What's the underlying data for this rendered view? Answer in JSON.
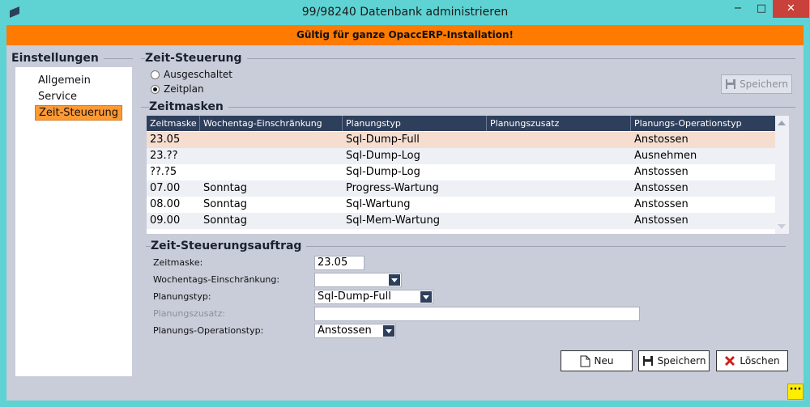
{
  "window": {
    "title": "99/98240 Datenbank administrieren",
    "min_icon": "minimize-icon",
    "max_icon": "maximize-icon",
    "close_icon": "close-icon",
    "min_glyph": "−",
    "max_glyph": "□",
    "close_glyph": "✕"
  },
  "banner": {
    "text": "Gültig für ganze OpaccERP-Installation!",
    "color": "#ff7a00"
  },
  "sidebar": {
    "title": "Einstellungen",
    "items": [
      {
        "label": "Allgemein",
        "active": false
      },
      {
        "label": "Service",
        "active": false
      },
      {
        "label": "Zeit-Steuerung",
        "active": true
      }
    ]
  },
  "zeitsteuerung": {
    "title": "Zeit-Steuerung",
    "options": [
      {
        "label": "Ausgeschaltet",
        "selected": false
      },
      {
        "label": "Zeitplan",
        "selected": true
      }
    ],
    "save_label": "Speichern"
  },
  "zeitmasken": {
    "title": "Zeitmasken",
    "columns": [
      "Zeitmaske",
      "Wochentag-Einschränkung",
      "Planungstyp",
      "Planungszusatz",
      "Planungs-Operationstyp"
    ],
    "rows": [
      [
        "23.05",
        "",
        "Sql-Dump-Full",
        "",
        "Anstossen"
      ],
      [
        "23.??",
        "",
        "Sql-Dump-Log",
        "",
        "Ausnehmen"
      ],
      [
        "??.?5",
        "",
        "Sql-Dump-Log",
        "",
        "Anstossen"
      ],
      [
        "07.00",
        "Sonntag",
        "Progress-Wartung",
        "",
        "Anstossen"
      ],
      [
        "08.00",
        "Sonntag",
        "Sql-Wartung",
        "",
        "Anstossen"
      ],
      [
        "09.00",
        "Sonntag",
        "Sql-Mem-Wartung",
        "",
        "Anstossen"
      ]
    ],
    "selected_row": 0
  },
  "auftrag": {
    "title": "Zeit-Steuerungsauftrag",
    "fields": {
      "zeitmaske": {
        "label": "Zeitmaske:",
        "value": "23.05"
      },
      "wochentag": {
        "label": "Wochentags-Einschränkung:",
        "value": ""
      },
      "planungstyp": {
        "label": "Planungstyp:",
        "value": "Sql-Dump-Full"
      },
      "planungszusatz": {
        "label": "Planungszusatz:",
        "value": ""
      },
      "operationstyp": {
        "label": "Planungs-Operationstyp:",
        "value": "Anstossen"
      }
    },
    "buttons": {
      "new": "Neu",
      "save": "Speichern",
      "delete": "Löschen"
    }
  },
  "statusbar": {
    "glyph": "···"
  }
}
